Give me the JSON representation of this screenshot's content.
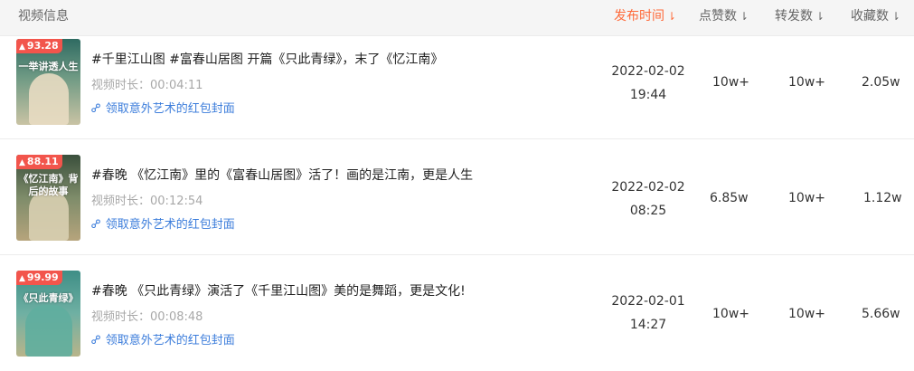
{
  "header": {
    "video_info": "视频信息",
    "publish_time": "发布时间",
    "likes": "点赞数",
    "shares": "转发数",
    "favorites": "收藏数",
    "sort_arrow": "⇂"
  },
  "rows": [
    {
      "score": "93.28",
      "thumb_text": "一举讲透人生",
      "title": "#千里江山图 #富春山居图 开篇《只此青绿》，末了《忆江南》",
      "duration_label": "视频时长：",
      "duration": "00:04:11",
      "link_label": "领取意外艺术的红包封面",
      "date": "2022-02-02",
      "time": "19:44",
      "likes": "10w+",
      "shares": "10w+",
      "favorites": "2.05w"
    },
    {
      "score": "88.11",
      "thumb_text": "《忆江南》背后的故事",
      "title": "#春晚 《忆江南》里的《富春山居图》活了！画的是江南，更是人生",
      "duration_label": "视频时长：",
      "duration": "00:12:54",
      "link_label": "领取意外艺术的红包封面",
      "date": "2022-02-02",
      "time": "08:25",
      "likes": "6.85w",
      "shares": "10w+",
      "favorites": "1.12w"
    },
    {
      "score": "99.99",
      "thumb_text": "《只此青绿》",
      "title": "#春晚 《只此青绿》演活了《千里江山图》美的是舞蹈，更是文化!",
      "duration_label": "视频时长：",
      "duration": "00:08:48",
      "link_label": "领取意外艺术的红包封面",
      "date": "2022-02-01",
      "time": "14:27",
      "likes": "10w+",
      "shares": "10w+",
      "favorites": "5.66w"
    }
  ],
  "colors": {
    "accent": "#fe6a3a",
    "link": "#3c7ddb",
    "badge": "#f2554c",
    "header_bg": "#f5f5f5"
  },
  "icons": {
    "badge_icon": "flame-icon",
    "link_icon": "link-icon",
    "sort_icon": "sort-down-icon"
  }
}
